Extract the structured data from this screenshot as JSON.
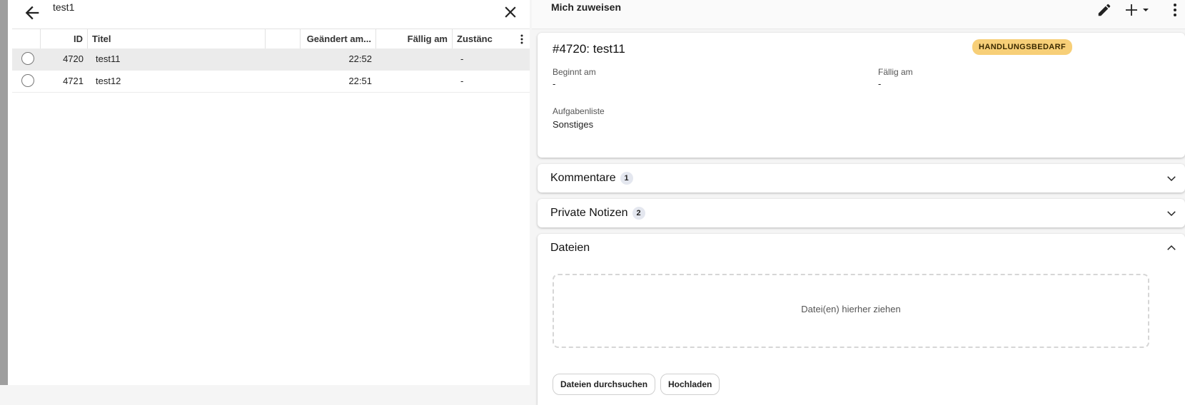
{
  "list": {
    "search_value": "test1",
    "columns": {
      "id": "ID",
      "title": "Titel",
      "changed": "Geändert am...",
      "due": "Fällig am",
      "assignee": "Zustänc"
    },
    "rows": [
      {
        "id": "4720",
        "title": "test11",
        "changed": "22:52",
        "assignee": "-",
        "selected": true
      },
      {
        "id": "4721",
        "title": "test12",
        "changed": "22:51",
        "assignee": "-",
        "selected": false
      }
    ]
  },
  "toolbar": {
    "assign_me_label": "Mich zuweisen"
  },
  "detail": {
    "title": "#4720: test11",
    "status_badge": "HANDLUNGSBEDARF",
    "status_color": "#f7cf78",
    "start_label": "Beginnt am",
    "start_value": "-",
    "due_label": "Fällig am",
    "due_value": "-",
    "tasklist_label": "Aufgabenliste",
    "tasklist_value": "Sonstiges"
  },
  "panels": {
    "comments": {
      "label": "Kommentare",
      "count": "1"
    },
    "private_notes": {
      "label": "Private Notizen",
      "count": "2"
    },
    "files": {
      "label": "Dateien",
      "drop_text": "Datei(en) hierher ziehen",
      "browse_label": "Dateien durchsuchen",
      "upload_label": "Hochladen"
    }
  },
  "icons": {
    "back": "arrow-left-icon",
    "clear": "close-icon",
    "edit": "pencil-icon",
    "add": "plus-icon",
    "more": "more-vertical-icon"
  }
}
